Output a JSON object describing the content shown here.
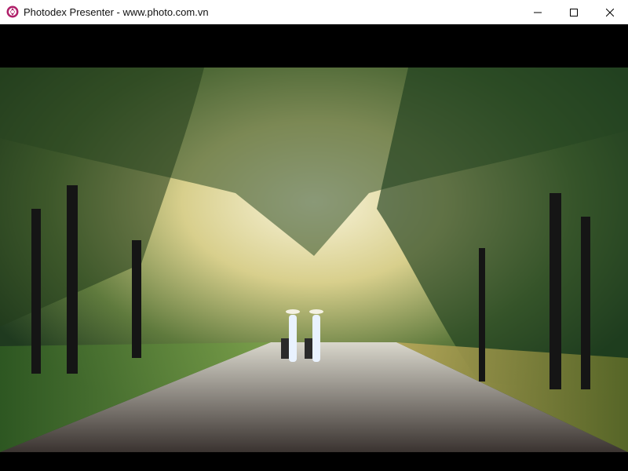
{
  "window": {
    "title": "Photodex Presenter - www.photo.com.vn"
  },
  "icons": {
    "app": "photodex-presenter-icon",
    "minimize": "minimize-icon",
    "maximize": "maximize-icon",
    "close": "close-icon"
  },
  "colors": {
    "titlebar_bg": "#ffffff",
    "viewport_bg": "#000000",
    "icon_accent": "#b0206a"
  },
  "slide": {
    "subject": "forest-road-photo"
  }
}
